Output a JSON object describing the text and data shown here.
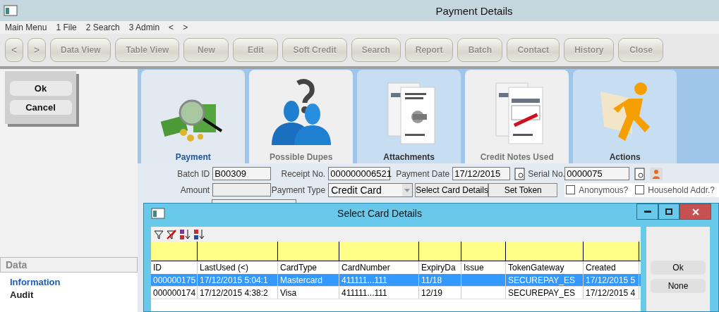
{
  "window": {
    "title": "Payment Details"
  },
  "menu": [
    "Main Menu",
    "1 File",
    "2 Search",
    "3 Admin",
    "<",
    ">"
  ],
  "toolbar": {
    "nav": [
      "<",
      ">"
    ],
    "buttons": [
      "Data View",
      "Table View",
      "New",
      "Edit",
      "Soft Credit",
      "Search",
      "Report",
      "Batch",
      "Contact",
      "History",
      "Close"
    ]
  },
  "confirm_buttons": [
    "Ok",
    "Cancel"
  ],
  "side_panel": {
    "header": "Data",
    "items": [
      {
        "label": "Information",
        "selected": true
      },
      {
        "label": "Audit",
        "selected": false
      }
    ]
  },
  "cards": [
    {
      "label": "Payment",
      "kind": "payment",
      "selected": true,
      "disabled": false
    },
    {
      "label": "Possible Dupes",
      "kind": "dupes",
      "selected": false,
      "disabled": true
    },
    {
      "label": "Attachments",
      "kind": "attachments",
      "selected": false,
      "disabled": false
    },
    {
      "label": "Credit Notes Used",
      "kind": "credit-notes",
      "selected": false,
      "disabled": true
    },
    {
      "label": "Actions",
      "kind": "actions",
      "selected": false,
      "disabled": false
    }
  ],
  "form": {
    "batch_id": {
      "label": "Batch ID",
      "value": "B00309"
    },
    "receipt_no": {
      "label": "Receipt No.",
      "value": "000000006521"
    },
    "payment_date": {
      "label": "Payment Date",
      "value": "17/12/2015"
    },
    "serial_no": {
      "label": "Serial No.",
      "value": "0000075"
    },
    "amount": {
      "label": "Amount"
    },
    "payment_type": {
      "label": "Payment Type",
      "value": "Credit Card"
    },
    "buttons": [
      "Select Card Details",
      "Set Token"
    ],
    "checkboxes": [
      {
        "label": "Anonymous?",
        "checked": false
      },
      {
        "label": "Household Addr.?",
        "checked": false
      }
    ]
  },
  "card_dialog": {
    "title": "Select Card Details",
    "columns": [
      "ID",
      "LastUsed (<)",
      "CardType",
      "CardNumber",
      "ExpiryDa",
      "Issue",
      "TokenGateway",
      "Created"
    ],
    "rows": [
      {
        "selected": true,
        "cells": [
          "000000175",
          "17/12/2015 5:04:1",
          "Mastercard",
          "411111...111",
          "11/18",
          "",
          "SECUREPAY_ES",
          "17/12/2015 5"
        ]
      },
      {
        "selected": false,
        "cells": [
          "000000174",
          "17/12/2015 4:38:2",
          "Visa",
          "411111...111",
          "12/19",
          "",
          "SECUREPAY_ES",
          "17/12/2015 4"
        ]
      }
    ],
    "buttons": [
      "Ok",
      "None"
    ]
  }
}
